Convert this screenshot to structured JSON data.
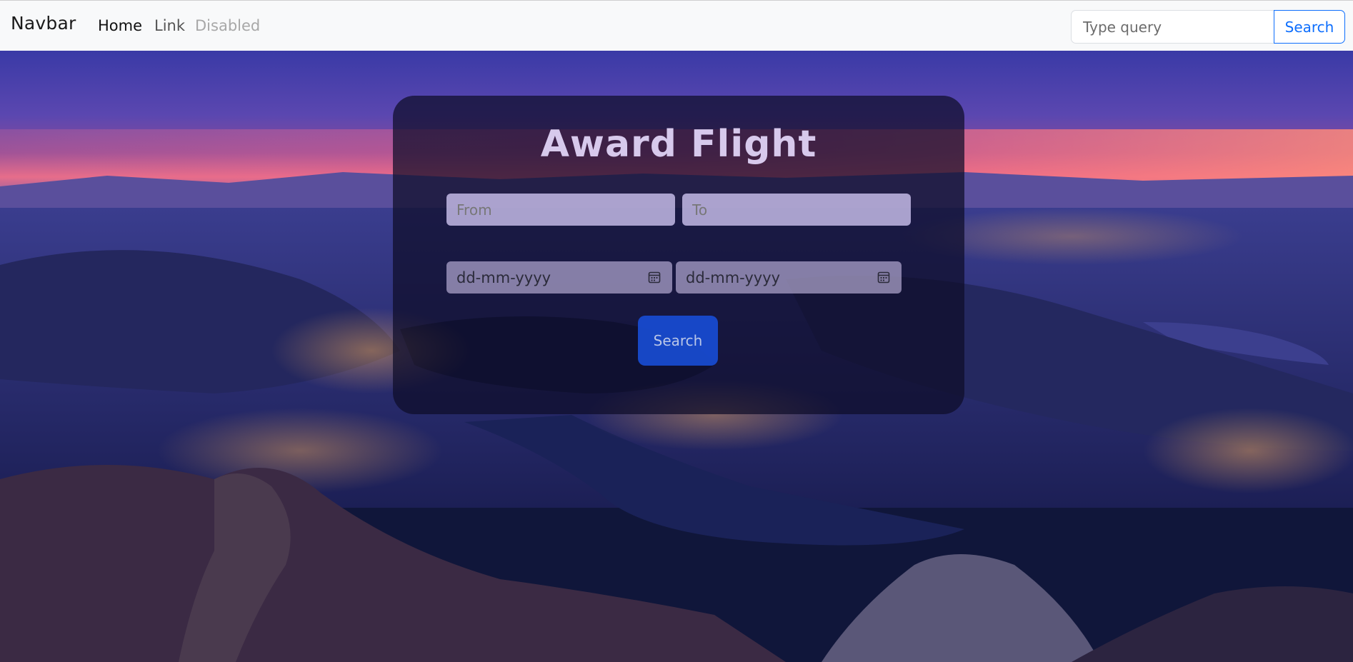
{
  "navbar": {
    "brand": "Navbar",
    "links": [
      "Home",
      "Link",
      "Disabled"
    ],
    "search_placeholder": "Type query",
    "search_button": "Search"
  },
  "form": {
    "title": "Award Flight",
    "from_placeholder": "From",
    "to_placeholder": "To",
    "date1_placeholder": "dd-mm-yyyy",
    "date2_placeholder": "dd-mm-yyyy",
    "submit_label": "Search"
  },
  "colors": {
    "accent": "#0d6efd",
    "navbar_bg": "#f8f9fa",
    "card_bg": "#0e0c28"
  }
}
